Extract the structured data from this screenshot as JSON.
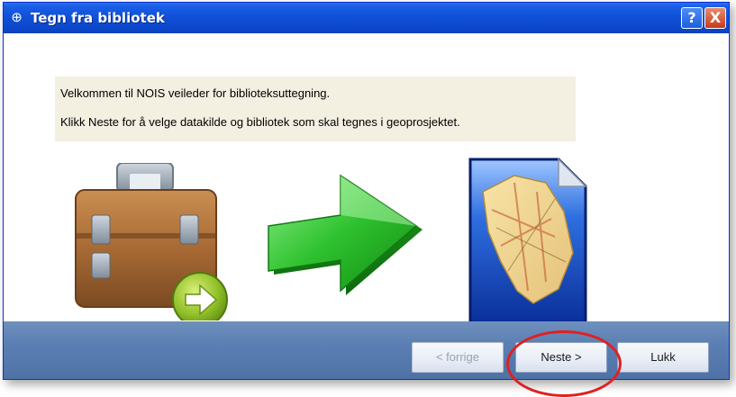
{
  "window": {
    "title": "Tegn fra bibliotek",
    "title_icon": "globe-icon",
    "help_label": "?",
    "close_label": "X"
  },
  "message": {
    "line1": "Velkommen til NOIS veileder for biblioteksuttegning.",
    "line2": "Klikk Neste for å velge datakilde og bibliotek som skal tegnes i geoprosjektet."
  },
  "illustration": {
    "items": [
      "briefcase-with-arrow-icon",
      "green-arrow-icon",
      "map-document-icon"
    ]
  },
  "buttons": {
    "prev": "< forrige",
    "next": "Neste >",
    "close": "Lukk"
  },
  "colors": {
    "titlebar": "#0f4fd6",
    "footer": "#5b7fb3",
    "message_bg": "#f3efe1",
    "highlight": "#e02020"
  }
}
